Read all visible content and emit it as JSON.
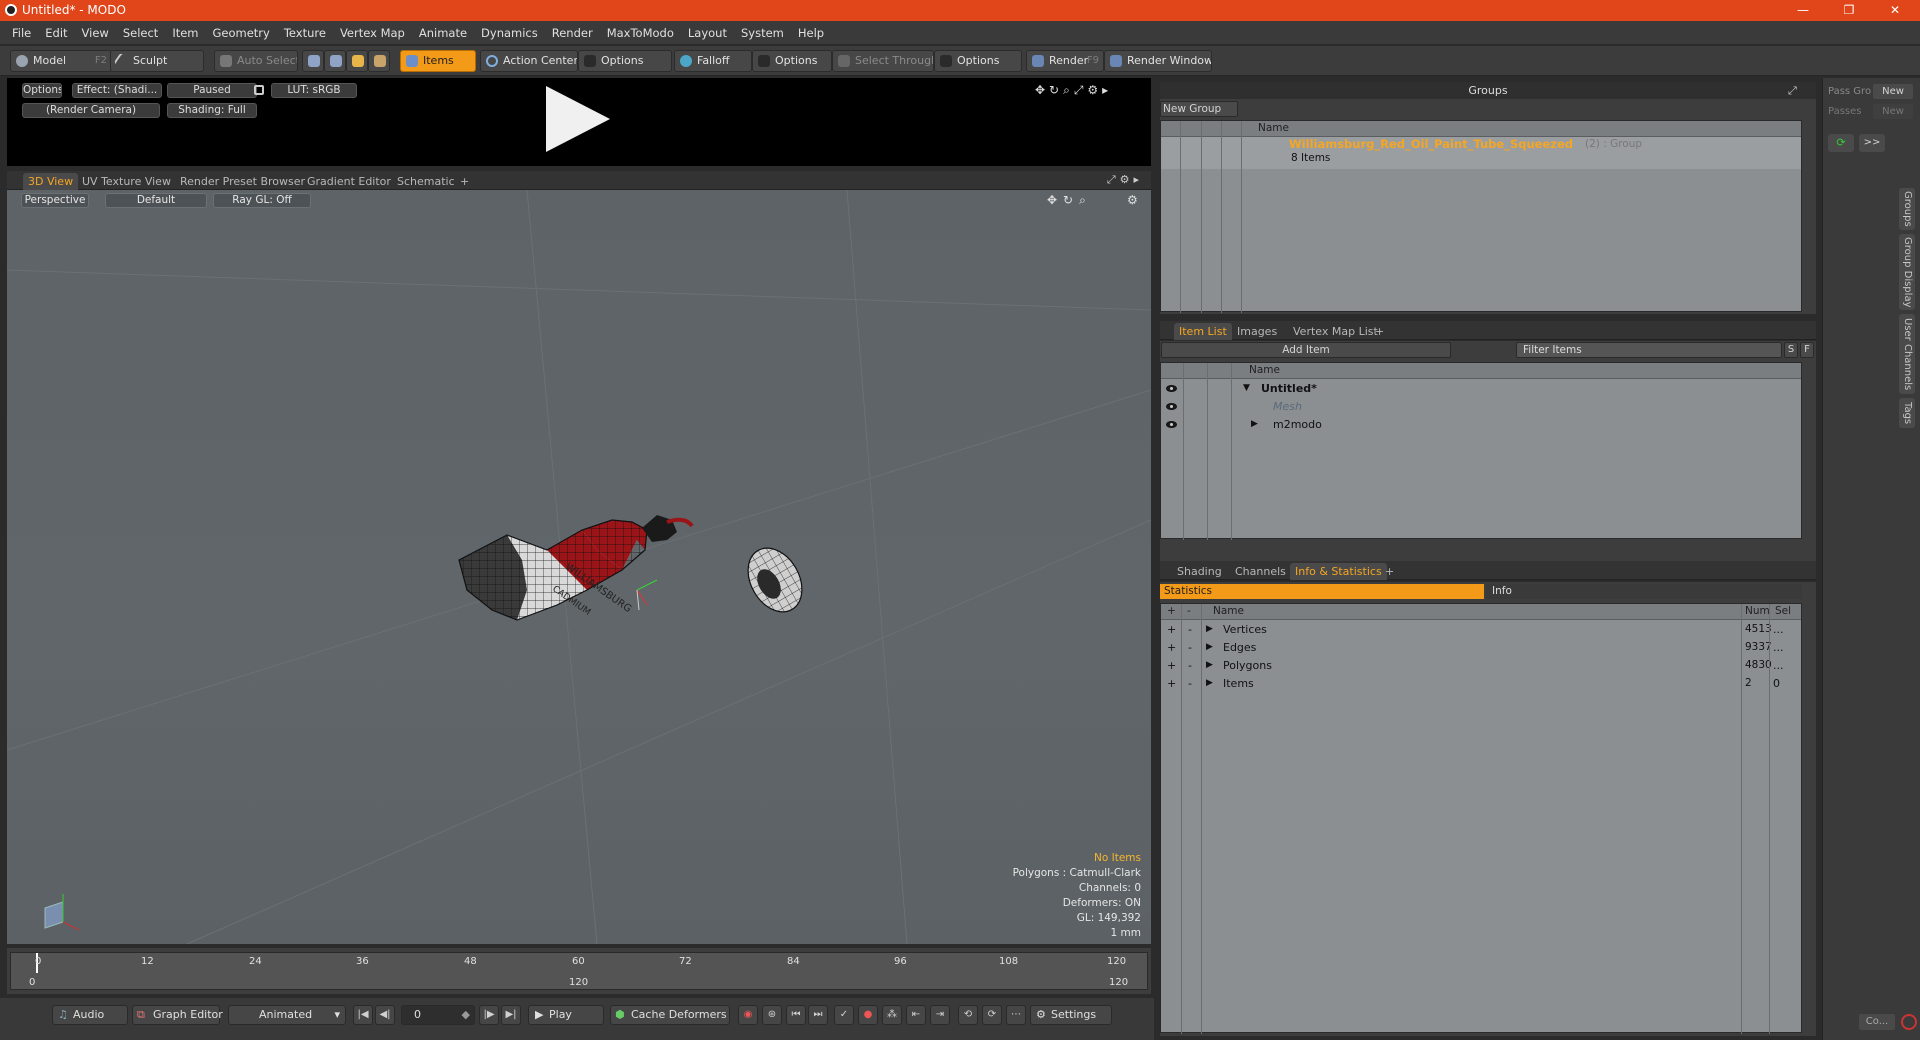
{
  "window": {
    "title": "Untitled* - MODO",
    "minimize": "—",
    "restore": "❐",
    "close": "✕"
  },
  "menu": [
    "File",
    "Edit",
    "View",
    "Select",
    "Item",
    "Geometry",
    "Texture",
    "Vertex Map",
    "Animate",
    "Dynamics",
    "Render",
    "MaxToModo",
    "Layout",
    "System",
    "Help"
  ],
  "toolbar": {
    "model": "Model",
    "model_key": "F2",
    "sculpt": "Sculpt",
    "auto_select": "Auto Select",
    "items": "Items",
    "action_center": "Action Center",
    "options1": "Options",
    "falloff": "Falloff",
    "options2": "Options",
    "select_through": "Select Through",
    "options3": "Options",
    "render": "Render",
    "render_key": "F9",
    "render_window": "Render Window"
  },
  "preview": {
    "options": "Options",
    "effect": "Effect: (Shadi...",
    "paused": "Paused",
    "lut": "LUT: sRGB",
    "camera": "(Render Camera)",
    "shading": "Shading: Full"
  },
  "viewtabs": [
    "3D View",
    "UV Texture View",
    "Render Preset Browser",
    "Gradient Editor",
    "Schematic",
    "+"
  ],
  "viewport": {
    "perspective": "Perspective",
    "default": "Default",
    "raygl": "Ray GL: Off",
    "stats": {
      "no_items": "No Items",
      "polygons": "Polygons : Catmull-Clark",
      "channels": "Channels: 0",
      "deformers": "Deformers: ON",
      "gl": "GL: 149,392",
      "unit": "1 mm"
    },
    "label_texts": [
      "WILLIAMSBURG",
      "CADMIUM"
    ]
  },
  "timeline": {
    "top_ticks": [
      "0",
      "12",
      "24",
      "36",
      "48",
      "60",
      "72",
      "84",
      "96",
      "108",
      "120"
    ],
    "bottom_ticks": [
      "0",
      "120",
      "120"
    ]
  },
  "bottombar": {
    "audio": "Audio",
    "graph_editor": "Graph Editor",
    "animated": "Animated",
    "frame": "0",
    "play": "Play",
    "cache": "Cache Deformers",
    "settings": "Settings"
  },
  "groups": {
    "title": "Groups",
    "new_group": "New Group",
    "col_name": "Name",
    "item_name": "Williamsburg_Red_Oil_Paint_Tube_Squeezed",
    "item_suffix": "(2) : Group",
    "item_count": "8 Items"
  },
  "itemlist": {
    "tabs": [
      "Item List",
      "Images",
      "Vertex Map List",
      "+"
    ],
    "add_item": "Add Item",
    "filter": "Filter Items",
    "s": "S",
    "f": "F",
    "col_name": "Name",
    "rows": [
      {
        "name": "Untitled*"
      },
      {
        "name": "Mesh"
      },
      {
        "name": "m2modo"
      }
    ]
  },
  "stats": {
    "tabs": [
      "Shading",
      "Channels",
      "Info & Statistics",
      "+"
    ],
    "statistics": "Statistics",
    "info": "Info",
    "cols": {
      "plus": "+",
      "minus": "-",
      "name": "Name",
      "num": "Num",
      "sel": "Sel"
    },
    "rows": [
      {
        "name": "Vertices",
        "num": "4513",
        "sel": "..."
      },
      {
        "name": "Edges",
        "num": "9337",
        "sel": "..."
      },
      {
        "name": "Polygons",
        "num": "4830",
        "sel": "..."
      },
      {
        "name": "Items",
        "num": "2",
        "sel": "0"
      }
    ]
  },
  "side": {
    "pass_group": "Pass Gro",
    "passes": "Passes",
    "new1": "New",
    "new2": "New",
    "arrows": ">>",
    "vtabs": [
      "Groups",
      "Group Display",
      "User Channels",
      "Tags"
    ],
    "co": "Co..."
  },
  "colors": {
    "accent": "#f39a18",
    "titlebar": "#e0461a",
    "tube_red": "#9a1418"
  }
}
